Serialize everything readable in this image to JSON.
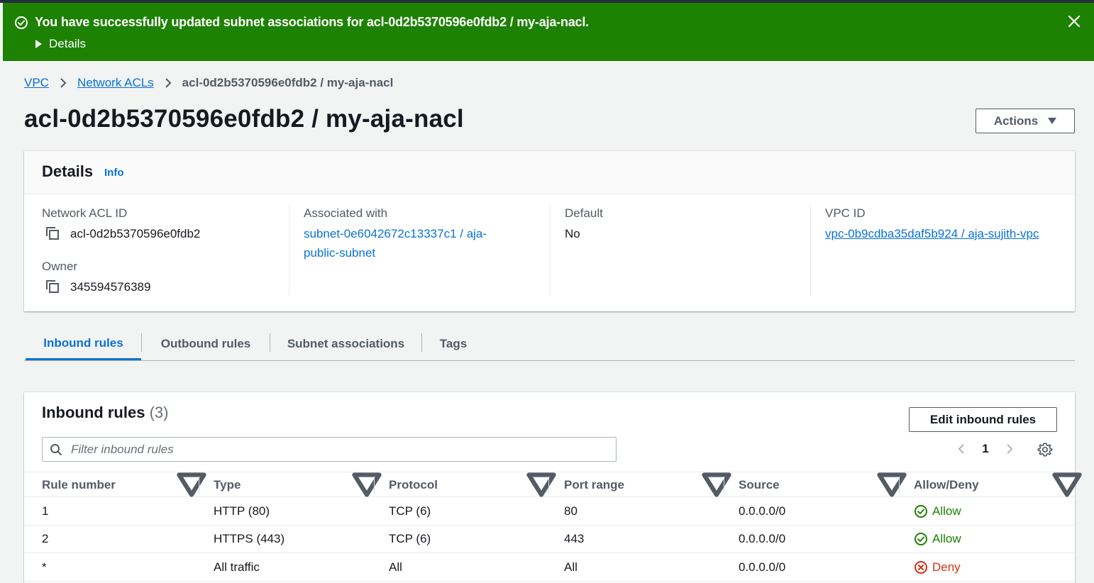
{
  "flash": {
    "message": "You have successfully updated subnet associations for acl-0d2b5370596e0fdb2 / my-aja-nacl.",
    "details_label": "Details",
    "color": "#1d8102"
  },
  "breadcrumb": {
    "items": [
      "VPC",
      "Network ACLs"
    ],
    "current": "acl-0d2b5370596e0fdb2 / my-aja-nacl"
  },
  "page": {
    "title": "acl-0d2b5370596e0fdb2 / my-aja-nacl",
    "actions_label": "Actions"
  },
  "details": {
    "heading": "Details",
    "info_label": "Info",
    "network_acl_id_label": "Network ACL ID",
    "network_acl_id": "acl-0d2b5370596e0fdb2",
    "owner_label": "Owner",
    "owner": "345594576389",
    "associated_with_label": "Associated with",
    "associated_with_line1": "subnet-0e6042672c13337c1 / aja-",
    "associated_with_line2": "public-subnet",
    "default_label": "Default",
    "default_value": "No",
    "vpc_id_label": "VPC ID",
    "vpc_id": "vpc-0b9cdba35daf5b924 / aja-sujith-vpc"
  },
  "tabs": [
    "Inbound rules",
    "Outbound rules",
    "Subnet associations",
    "Tags"
  ],
  "rules": {
    "title": "Inbound rules",
    "count": "(3)",
    "edit_label": "Edit inbound rules",
    "filter_placeholder": "Filter inbound rules",
    "current_page": "1",
    "columns": [
      "Rule number",
      "Type",
      "Protocol",
      "Port range",
      "Source",
      "Allow/Deny"
    ],
    "rows": [
      {
        "rule": "1",
        "type": "HTTP (80)",
        "protocol": "TCP (6)",
        "port": "80",
        "source": "0.0.0.0/0",
        "action": "Allow"
      },
      {
        "rule": "2",
        "type": "HTTPS (443)",
        "protocol": "TCP (6)",
        "port": "443",
        "source": "0.0.0.0/0",
        "action": "Allow"
      },
      {
        "rule": "*",
        "type": "All traffic",
        "protocol": "All",
        "port": "All",
        "source": "0.0.0.0/0",
        "action": "Deny"
      }
    ]
  },
  "colors": {
    "link": "#0972d3",
    "allow": "#1d8102",
    "deny": "#d13212"
  },
  "icons": [
    "success-check-icon",
    "caret-right-icon",
    "close-icon",
    "chevron-right-icon",
    "caret-down-icon",
    "copy-icon",
    "search-icon",
    "chevron-left-icon",
    "settings-gear-icon",
    "sort-down-icon",
    "allow-check-icon",
    "deny-x-icon"
  ]
}
